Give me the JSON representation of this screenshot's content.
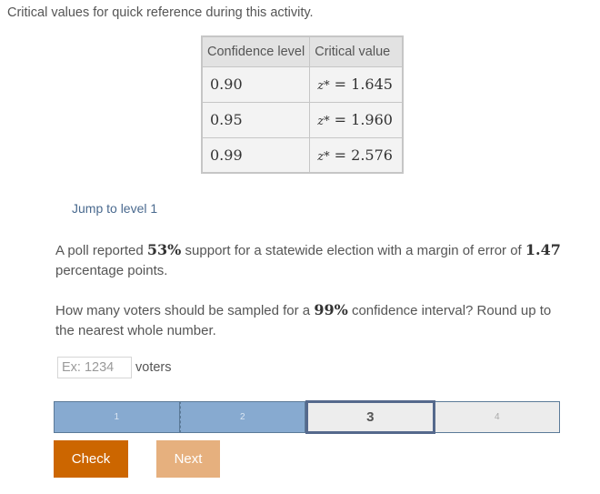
{
  "intro": "Critical values for quick reference during this activity.",
  "table": {
    "headers": [
      "Confidence level",
      "Critical value"
    ],
    "rows": [
      {
        "level": "0.90",
        "var": "z*",
        "eq": "= 1.645"
      },
      {
        "level": "0.95",
        "var": "z*",
        "eq": "= 1.960"
      },
      {
        "level": "0.99",
        "var": "z*",
        "eq": "= 2.576"
      }
    ]
  },
  "jump_link": "Jump to level 1",
  "question": {
    "p1_pre": "A poll reported ",
    "p1_pct": "53%",
    "p1_mid": " support for a statewide election with a margin of error of ",
    "p1_moe": "1.47",
    "p1_post": " percentage points.",
    "p2_pre": "How many voters should be sampled for a ",
    "p2_conf": "99%",
    "p2_post": " confidence interval? Round up to the nearest whole number."
  },
  "answer": {
    "placeholder": "Ex: 1234",
    "value": "",
    "unit": "voters"
  },
  "progress": {
    "levels": [
      "1",
      "2",
      "3",
      "4"
    ],
    "current": 3,
    "completed": 2
  },
  "buttons": {
    "check": "Check",
    "next": "Next"
  },
  "colors": {
    "check": "#cc6600",
    "next_disabled": "#e6b07e",
    "level_done": "#87aad0",
    "level_current_border": "#55698c"
  }
}
